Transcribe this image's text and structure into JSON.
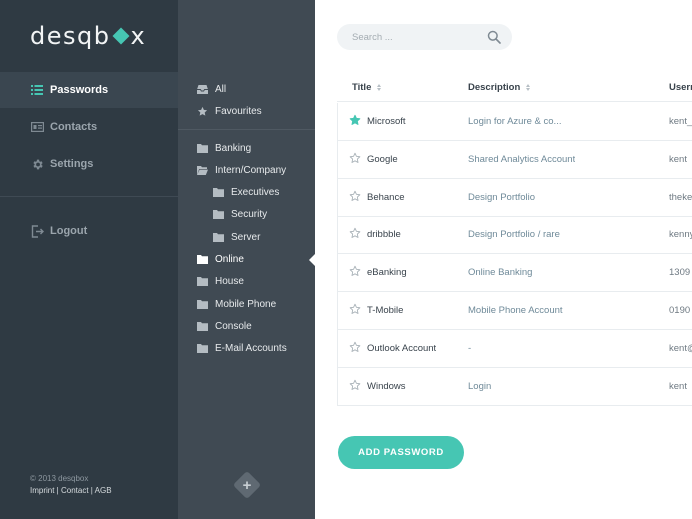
{
  "brand": {
    "logo_left": "desqb",
    "logo_right": "x",
    "accent": "#46c6b3"
  },
  "nav": {
    "items": [
      {
        "label": "Passwords",
        "icon": "list-icon",
        "active": true
      },
      {
        "label": "Contacts",
        "icon": "id-card-icon"
      },
      {
        "label": "Settings",
        "icon": "gear-icon"
      },
      {
        "label": "Logout",
        "icon": "logout-icon"
      }
    ],
    "footer": {
      "copyright": "© 2013 desqbox",
      "imprint": "Imprint",
      "contact": "Contact",
      "agb": "AGB",
      "sep": " | "
    }
  },
  "folders": {
    "top": [
      {
        "label": "All",
        "icon": "inbox-icon"
      },
      {
        "label": "Favourites",
        "icon": "star-icon"
      }
    ],
    "list": [
      {
        "label": "Banking",
        "icon": "folder-icon"
      },
      {
        "label": "Intern/Company",
        "icon": "folder-open-icon"
      },
      {
        "label": "Executives",
        "icon": "folder-icon",
        "sub": true
      },
      {
        "label": "Security",
        "icon": "folder-icon",
        "sub": true
      },
      {
        "label": "Server",
        "icon": "folder-icon",
        "sub": true
      },
      {
        "label": "Online",
        "icon": "folder-icon",
        "active": true
      },
      {
        "label": "House",
        "icon": "folder-icon"
      },
      {
        "label": "Mobile Phone",
        "icon": "folder-icon"
      },
      {
        "label": "Console",
        "icon": "folder-icon"
      },
      {
        "label": "E-Mail Accounts",
        "icon": "folder-icon"
      }
    ],
    "add_icon": "plus-icon"
  },
  "search": {
    "placeholder": "Search ...",
    "value": ""
  },
  "table": {
    "columns": {
      "title": "Title",
      "description": "Description",
      "username": "Userna"
    },
    "rows": [
      {
        "title": "Microsoft",
        "description": "Login for Azure & co...",
        "username": "kent_",
        "favourite": true
      },
      {
        "title": "Google",
        "description": "Shared Analytics Account",
        "username": "kent",
        "favourite": false
      },
      {
        "title": "Behance",
        "description": "Design Portfolio",
        "username": "theke",
        "favourite": false
      },
      {
        "title": "dribbble",
        "description": "Design Portfolio / rare",
        "username": "kenny",
        "favourite": false
      },
      {
        "title": "eBanking",
        "description": "Online Banking",
        "username": "1309",
        "favourite": false
      },
      {
        "title": "T-Mobile",
        "description": "Mobile Phone Account",
        "username": "0190",
        "favourite": false
      },
      {
        "title": "Outlook Account",
        "description": "-",
        "username": "kent@",
        "favourite": false
      },
      {
        "title": "Windows",
        "description": "Login",
        "username": "kent",
        "favourite": false
      }
    ]
  },
  "actions": {
    "add_password": "ADD PASSWORD"
  }
}
